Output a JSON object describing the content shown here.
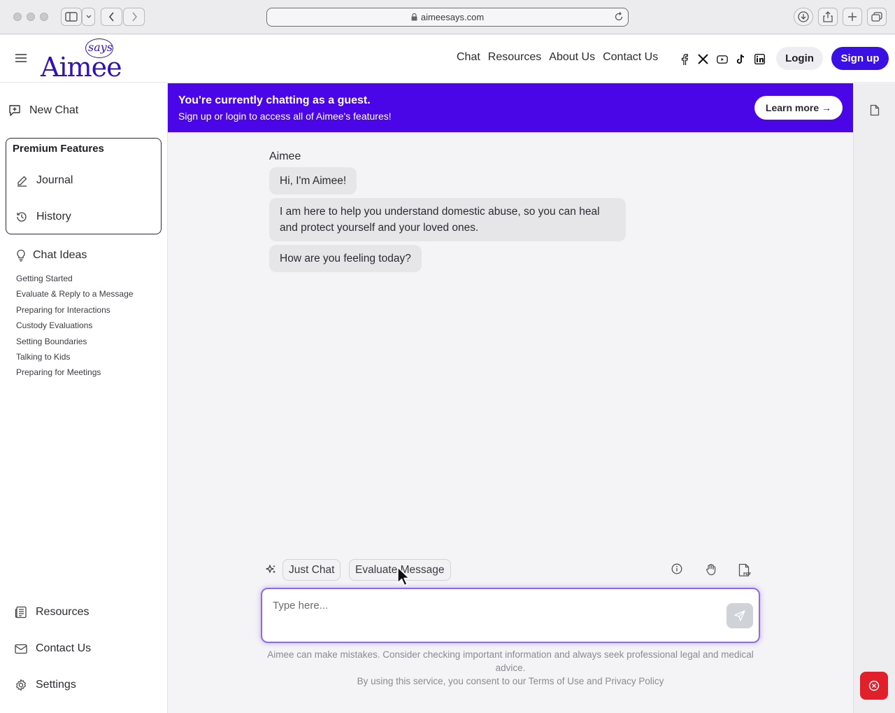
{
  "browser": {
    "url": "aimeesays.com"
  },
  "header": {
    "logo_main": "Aimee",
    "logo_says": "says",
    "nav": [
      "Chat",
      "Resources",
      "About Us",
      "Contact Us"
    ],
    "socials": [
      "facebook-icon",
      "x-icon",
      "youtube-icon",
      "tiktok-icon",
      "linkedin-icon"
    ],
    "login_label": "Login",
    "signup_label": "Sign up",
    "brand_color": "#3a10e5"
  },
  "sidebar": {
    "new_chat": "New Chat",
    "premium_title": "Premium Features",
    "journal": "Journal",
    "history": "History",
    "chat_ideas_title": "Chat Ideas",
    "chat_ideas": [
      "Getting Started",
      "Evaluate & Reply to a Message",
      "Preparing for Interactions",
      "Custody Evaluations",
      "Setting Boundaries",
      "Talking to Kids",
      "Preparing for Meetings"
    ],
    "bottom": {
      "resources": "Resources",
      "contact": "Contact Us",
      "settings": "Settings"
    }
  },
  "banner": {
    "title": "You're currently chatting as a guest.",
    "subtitle": "Sign up or login to access all of Aimee's features!",
    "learn_more": "Learn more →",
    "color": "#4a06e6"
  },
  "chat": {
    "sender": "Aimee",
    "messages": [
      "Hi, I'm Aimee!",
      "I am here to help you understand domestic abuse, so you can heal and protect yourself and your loved ones.",
      "How are you feeling today?"
    ]
  },
  "composer": {
    "modes": [
      "Just Chat",
      "Evaluate Message"
    ],
    "placeholder": "Type here...",
    "disclaimer": "Aimee can make mistakes. Consider checking important information and always seek professional legal and medical advice.",
    "consent_prefix": "By using this service, you consent to our",
    "terms_link": "Terms of Use",
    "and": "and",
    "privacy_link": "Privacy Policy"
  }
}
